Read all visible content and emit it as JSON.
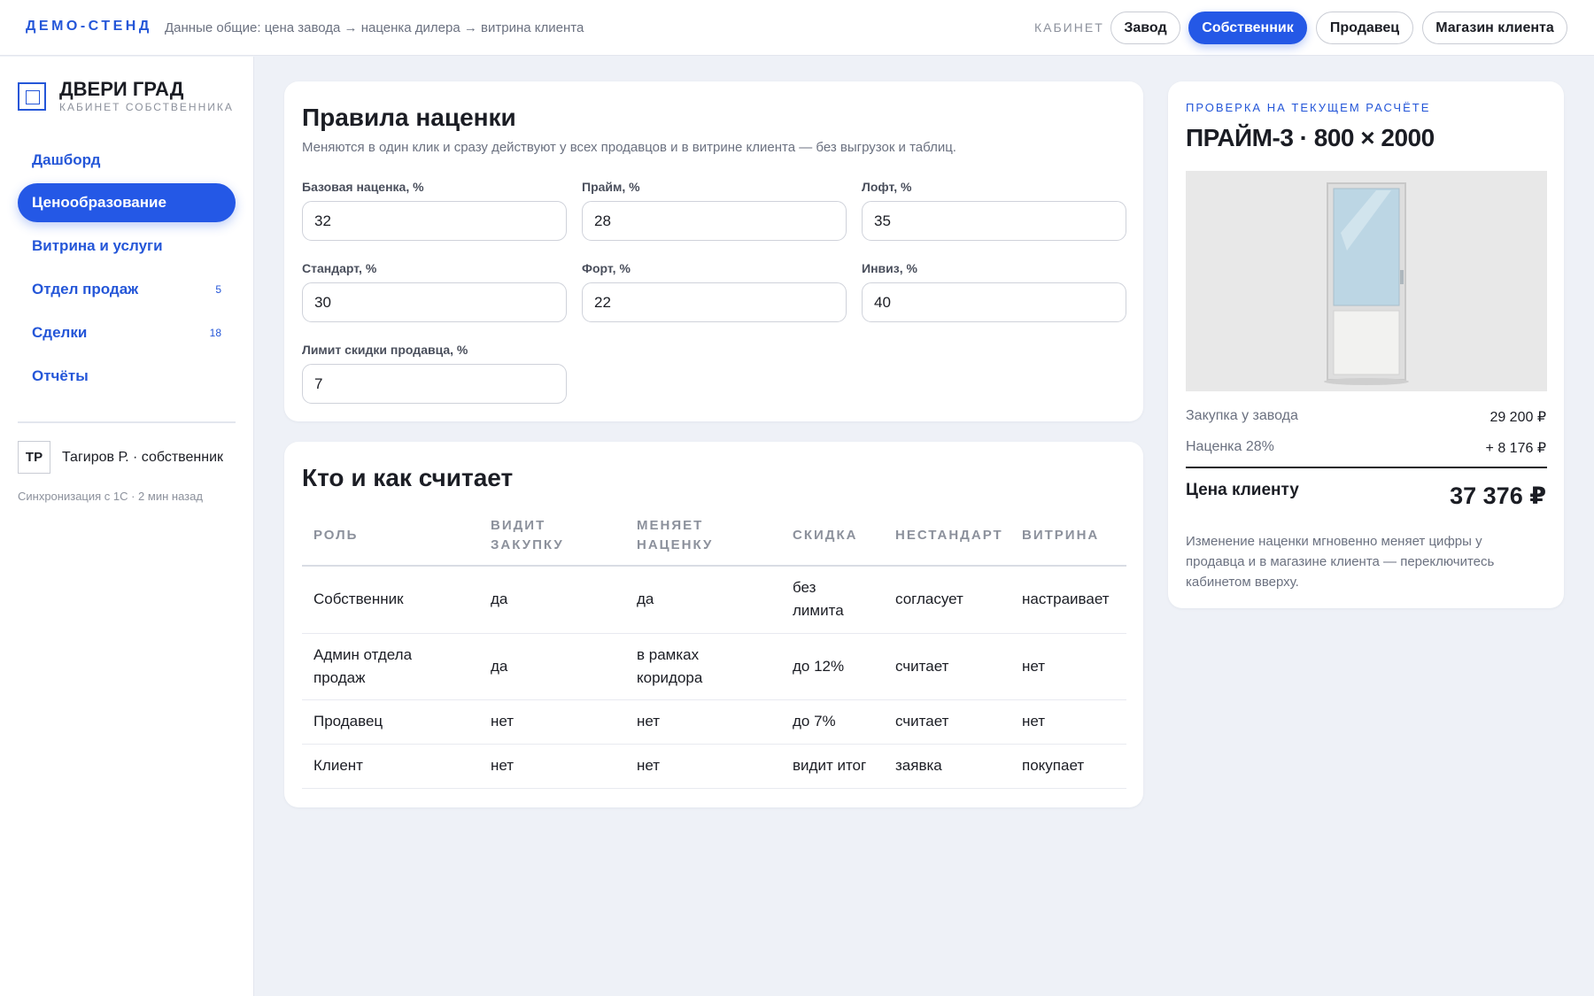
{
  "topbar": {
    "brand": "ДЕМО-СТЕНД",
    "breadcrumb": "Данные общие: цена завода → наценка дилера → витрина клиента",
    "cabinet_label": "КАБИНЕТ",
    "cabinets": [
      "Завод",
      "Собственник",
      "Продавец",
      "Магазин клиента"
    ],
    "active_cabinet": "Собственник"
  },
  "sidebar": {
    "company": "ДВЕРИ ГРАД",
    "company_sub": "КАБИНЕТ СОБСТВЕННИКА",
    "items": [
      {
        "label": "Дашборд",
        "badge": ""
      },
      {
        "label": "Ценообразование",
        "badge": ""
      },
      {
        "label": "Витрина и услуги",
        "badge": ""
      },
      {
        "label": "Отдел продаж",
        "badge": "5"
      },
      {
        "label": "Сделки",
        "badge": "18"
      },
      {
        "label": "Отчёты",
        "badge": ""
      }
    ],
    "active_item": "Ценообразование",
    "user_initials": "ТР",
    "user_name": "Тагиров Р. · собственник",
    "sync": "Синхронизация с 1С · 2 мин назад"
  },
  "markup": {
    "title": "Правила наценки",
    "subtitle": "Меняются в один клик и сразу действуют у всех продавцов и в витрине клиента — без выгрузок и таблиц.",
    "fields": [
      {
        "label": "Базовая наценка, %",
        "value": "32"
      },
      {
        "label": "Прайм, %",
        "value": "28"
      },
      {
        "label": "Лофт, %",
        "value": "35"
      },
      {
        "label": "Стандарт, %",
        "value": "30"
      },
      {
        "label": "Форт, %",
        "value": "22"
      },
      {
        "label": "Инвиз, %",
        "value": "40"
      },
      {
        "label": "Лимит скидки продавца, %",
        "value": "7"
      }
    ]
  },
  "roles": {
    "title": "Кто и как считает",
    "headers": [
      "РОЛЬ",
      "ВИДИТ\nЗАКУПКУ",
      "МЕНЯЕТ\nНАЦЕНКУ",
      "СКИДКА",
      "НЕСТАНДАРТ",
      "ВИТРИНА"
    ],
    "rows": [
      [
        "Собственник",
        "да",
        "да",
        "без\nлимита",
        "согласует",
        "настраивает"
      ],
      [
        "Админ отдела\nпродаж",
        "да",
        "в рамках\nкоридора",
        "до 12%",
        "считает",
        "нет"
      ],
      [
        "Продавец",
        "нет",
        "нет",
        "до 7%",
        "считает",
        "нет"
      ],
      [
        "Клиент",
        "нет",
        "нет",
        "видит итог",
        "заявка",
        "покупает"
      ]
    ]
  },
  "check": {
    "eyebrow": "ПРОВЕРКА НА ТЕКУЩЕМ РАСЧЁТЕ",
    "product": "ПРАЙМ-3 · 800 × 2000",
    "purchase_label": "Закупка у завода",
    "purchase_value": "29 200 ₽",
    "markup_label": "Наценка 28%",
    "markup_value": "+ 8 176 ₽",
    "total_label": "Цена клиенту",
    "total_value": "37 376 ₽",
    "note": "Изменение наценки мгновенно меняет цифры у продавца и в магазине клиента — переключитесь кабинетом вверху."
  },
  "colors": {
    "accent": "#2458e6",
    "background": "#eef1f7"
  }
}
